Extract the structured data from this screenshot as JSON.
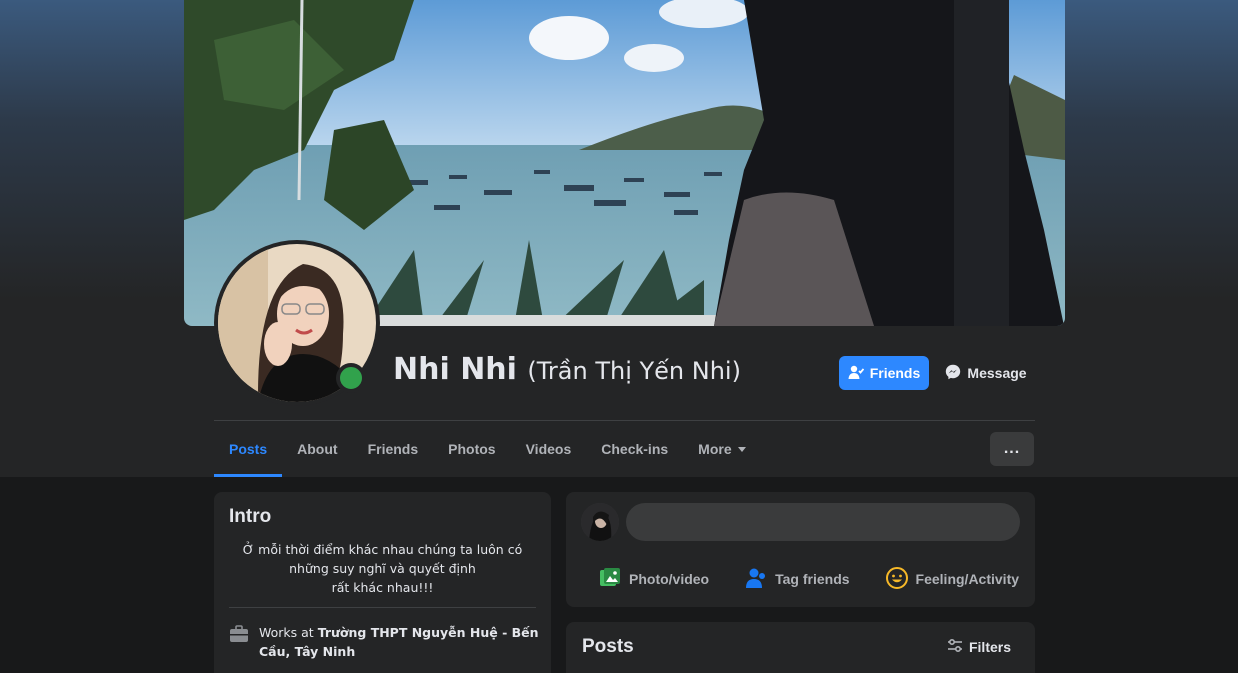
{
  "profile": {
    "name": "Nhi Nhi",
    "alternate_name": "(Trần Thị Yến Nhi)",
    "online_status_color": "#31a24c"
  },
  "actions": {
    "friends_label": "Friends",
    "message_label": "Message"
  },
  "tabs": [
    {
      "label": "Posts",
      "active": true
    },
    {
      "label": "About"
    },
    {
      "label": "Friends"
    },
    {
      "label": "Photos"
    },
    {
      "label": "Videos"
    },
    {
      "label": "Check-ins"
    },
    {
      "label": "More"
    }
  ],
  "more_menu_label": "...",
  "intro": {
    "title": "Intro",
    "bio_lines": [
      "Ở mỗi thời điểm khác nhau chúng ta luôn có",
      "những suy nghĩ và quyết định",
      "rất khác nhau!!!"
    ],
    "works_prefix": "Works at ",
    "works_place": "Trường THPT Nguyễn Huệ - Bến Cầu, Tây Ninh"
  },
  "composer": {
    "placeholder": "",
    "photo_video": "Photo/video",
    "tag_friends": "Tag friends",
    "feeling_activity": "Feeling/Activity"
  },
  "posts": {
    "title": "Posts",
    "filters_label": "Filters"
  },
  "colors": {
    "accent": "#2d88ff",
    "background": "#18191a",
    "card": "#242526"
  },
  "icons": {
    "friends_button": "person-check-icon",
    "message_button": "messenger-icon",
    "works": "briefcase-icon",
    "photo_video": "photo-icon",
    "tag_friends": "tag-people-icon",
    "feeling": "smiley-icon",
    "filters": "sliders-icon"
  }
}
